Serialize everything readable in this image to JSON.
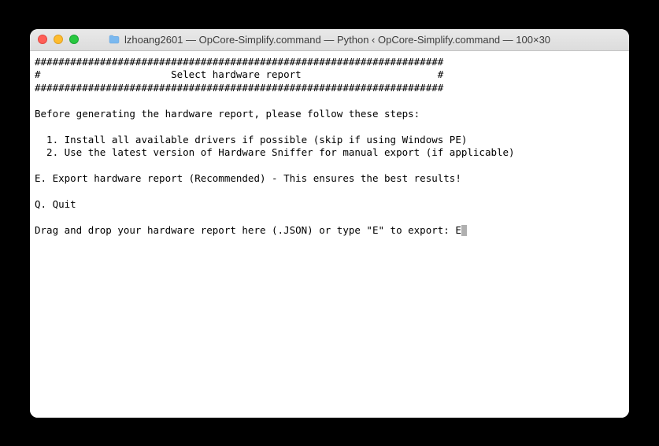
{
  "window": {
    "title": "lzhoang2601 — OpCore-Simplify.command — Python ‹ OpCore-Simplify.command — 100×30"
  },
  "terminal": {
    "border_top": "#####################################################################",
    "header_line": "#                      Select hardware report                       #",
    "border_bottom": "#####################################################################",
    "intro": "Before generating the hardware report, please follow these steps:",
    "step1": "  1. Install all available drivers if possible (skip if using Windows PE)",
    "step2": "  2. Use the latest version of Hardware Sniffer for manual export (if applicable)",
    "option_e": "E. Export hardware report (Recommended) - This ensures the best results!",
    "option_q": "Q. Quit",
    "prompt": "Drag and drop your hardware report here (.JSON) or type \"E\" to export: ",
    "input_value": "E"
  }
}
